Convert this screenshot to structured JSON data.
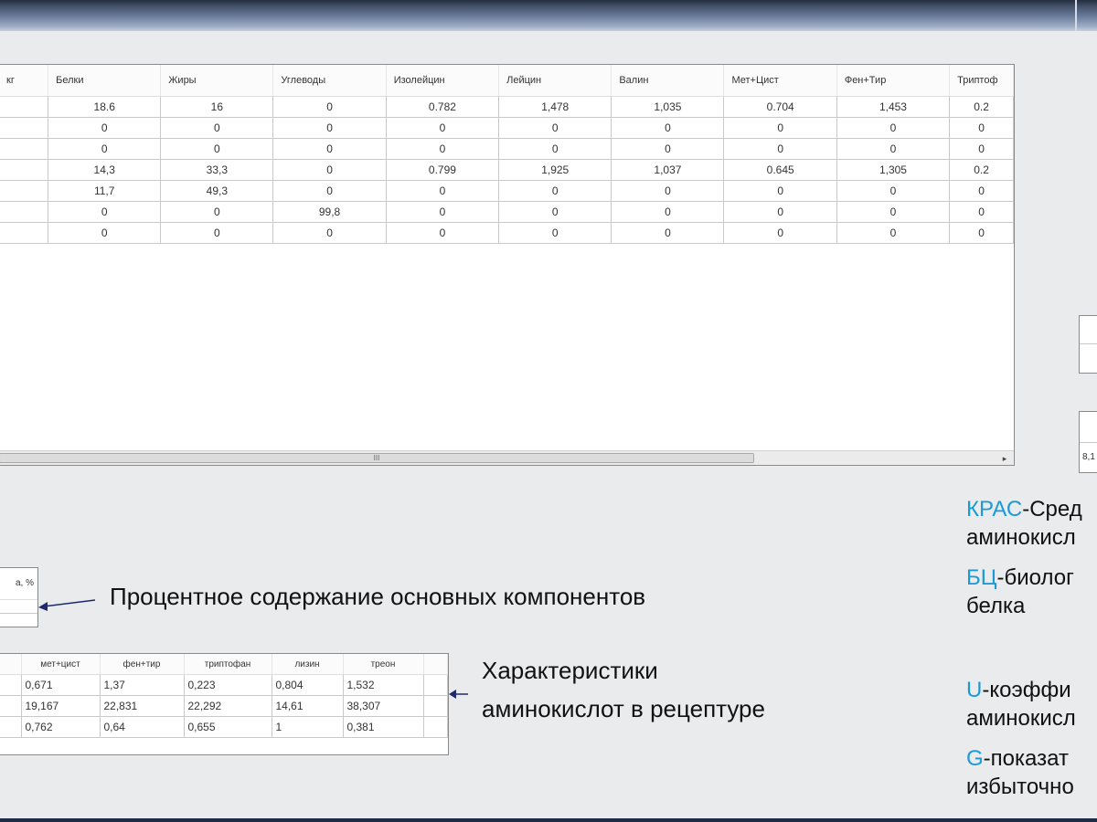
{
  "main_table": {
    "columns": [
      "кг",
      "Белки",
      "Жиры",
      "Углеводы",
      "Изолейцин",
      "Лейцин",
      "Валин",
      "Мет+Цист",
      "Фен+Тир",
      "Триптоф"
    ],
    "rows": [
      [
        "",
        "18.6",
        "16",
        "0",
        "0.782",
        "1,478",
        "1,035",
        "0.704",
        "1,453",
        "0.2"
      ],
      [
        "",
        "0",
        "0",
        "0",
        "0",
        "0",
        "0",
        "0",
        "0",
        "0"
      ],
      [
        "",
        "0",
        "0",
        "0",
        "0",
        "0",
        "0",
        "0",
        "0",
        "0"
      ],
      [
        "",
        "14,3",
        "33,3",
        "0",
        "0.799",
        "1,925",
        "1,037",
        "0.645",
        "1,305",
        "0.2"
      ],
      [
        "",
        "11,7",
        "49,3",
        "0",
        "0",
        "0",
        "0",
        "0",
        "0",
        "0"
      ],
      [
        "",
        "0",
        "0",
        "99,8",
        "0",
        "0",
        "0",
        "0",
        "0",
        "0"
      ],
      [
        "",
        "0",
        "0",
        "0",
        "0",
        "0",
        "0",
        "0",
        "0",
        "0"
      ]
    ]
  },
  "scrollbar": {
    "thumb_grip": "III",
    "arrow": "▸"
  },
  "right_box_value": "8,1",
  "percent_box": {
    "header": "а, %"
  },
  "amino_table": {
    "columns": [
      "",
      "мет+цист",
      "фен+тир",
      "триптофан",
      "лизин",
      "треон"
    ],
    "rows": [
      [
        "",
        "0,671",
        "1,37",
        "0,223",
        "0,804",
        "1,532"
      ],
      [
        "",
        "19,167",
        "22,831",
        "22,292",
        "14,61",
        "38,307"
      ],
      [
        "",
        "0,762",
        "0,64",
        "0,655",
        "1",
        "0,381"
      ]
    ]
  },
  "annotations": {
    "percent_label": "Процентное содержание основных компонентов",
    "amino_label_line1": "Характеристики",
    "amino_label_line2": "аминокислот в рецептуре"
  },
  "legend": {
    "kras_abbr": "КРАС",
    "kras_text": "-Сред",
    "kras_text2": "аминокисл",
    "bc_abbr": "БЦ",
    "bc_text": "-биолог",
    "bc_text2": "белка",
    "u_abbr": "U",
    "u_text": "-коэффи",
    "u_text2": "аминокисл",
    "g_abbr": "G",
    "g_text": "-показат",
    "g_text2": "избыточно"
  },
  "colors": {
    "accent": "#1a9ad6",
    "arrow": "#1f2a6e"
  }
}
